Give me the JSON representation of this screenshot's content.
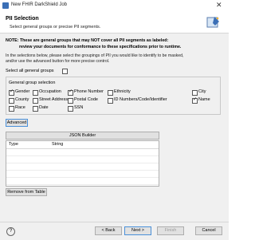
{
  "window": {
    "title": "New FHIR DarkShield Job",
    "close_icon": "close-icon"
  },
  "header": {
    "title": "PII Selection",
    "description": "Select general groups or precise PII segments.",
    "icon": "wizard-banner-icon"
  },
  "note": {
    "line1": "NOTE: These are general groups that may NOT cover all PII segments as labeled:",
    "line2": "review your documents for conformance to these specifications prior to runtime."
  },
  "info": {
    "line1": "In the selections below, please select the groupings of PII you would like to identify to be masked,",
    "line2": "and/or use the advanced button for more precise control."
  },
  "select_all": {
    "label": "Select all general groups",
    "checked": false
  },
  "general_groups": {
    "title": "General group selection",
    "items": [
      {
        "label": "Gender",
        "checked": true
      },
      {
        "label": "Occupation",
        "checked": false
      },
      {
        "label": "Phone Number",
        "checked": true
      },
      {
        "label": "Ethnicity",
        "checked": false
      },
      {
        "label": "City",
        "checked": false
      },
      {
        "label": "County",
        "checked": false
      },
      {
        "label": "Street Address",
        "checked": false
      },
      {
        "label": "Postal Code",
        "checked": false
      },
      {
        "label": "ID Numbers/Code/Identifier",
        "checked": false
      },
      {
        "label": "Name",
        "checked": true
      },
      {
        "label": "Race",
        "checked": false
      },
      {
        "label": "Date",
        "checked": false
      },
      {
        "label": "SSN",
        "checked": false
      }
    ]
  },
  "advanced_button": "Advanced",
  "json_builder_button": "JSON Builder",
  "table": {
    "columns": [
      "Type",
      "String"
    ],
    "rows": []
  },
  "remove_button": "Remove from Table",
  "footer": {
    "help": "?",
    "back": "< Back",
    "next": "Next >",
    "finish": "Finish",
    "cancel": "Cancel"
  }
}
